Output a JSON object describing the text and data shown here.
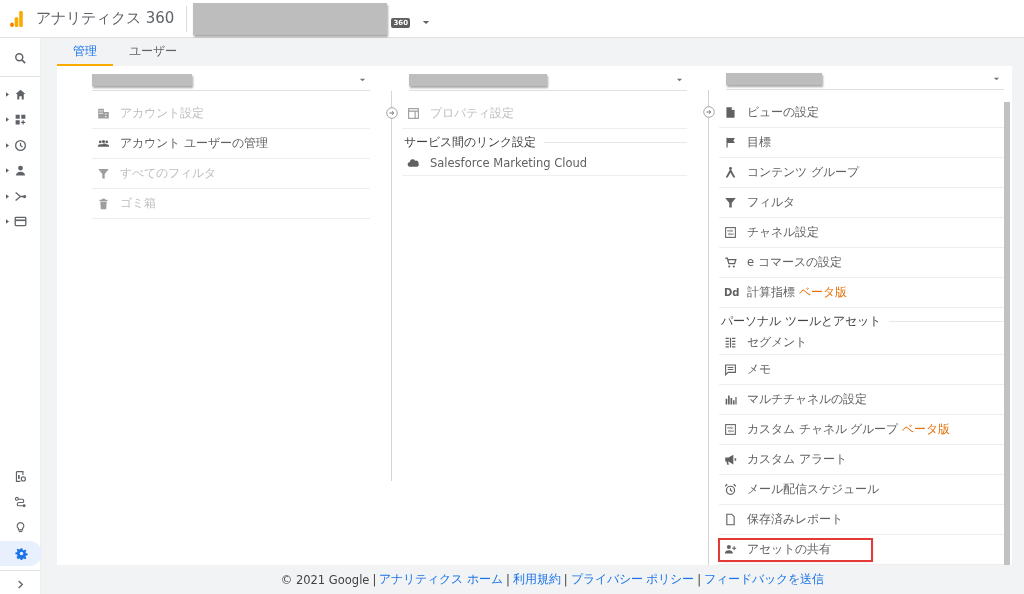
{
  "header": {
    "product": "アナリティクス 360",
    "badge": "360"
  },
  "tabs": [
    {
      "label": "管理",
      "selected": true
    },
    {
      "label": "ユーザー",
      "selected": false
    }
  ],
  "sidebar": {
    "top": [
      {
        "expandable": false,
        "selected": false
      },
      {
        "expandable": true,
        "selected": false
      },
      {
        "expandable": true,
        "selected": false
      },
      {
        "expandable": true,
        "selected": false
      },
      {
        "expandable": true,
        "selected": false
      },
      {
        "expandable": true,
        "selected": false
      },
      {
        "expandable": true,
        "selected": false
      }
    ],
    "bottom": [
      {
        "selected": false
      },
      {
        "selected": false
      },
      {
        "selected": false
      },
      {
        "selected": true
      }
    ]
  },
  "columns": [
    {
      "items": [
        {
          "kind": "item",
          "label": "アカウント設定",
          "disabled": true
        },
        {
          "kind": "item",
          "label": "アカウント ユーザーの管理",
          "disabled": false
        },
        {
          "kind": "item",
          "label": "すべてのフィルタ",
          "disabled": true
        },
        {
          "kind": "item",
          "label": "ゴミ箱",
          "disabled": true
        }
      ]
    },
    {
      "items": [
        {
          "kind": "item",
          "label": "プロパティ設定",
          "disabled": true
        },
        {
          "kind": "section",
          "label": "サービス間のリンク設定"
        },
        {
          "kind": "item",
          "label": "Salesforce Marketing Cloud",
          "disabled": false
        }
      ]
    },
    {
      "items": [
        {
          "kind": "item",
          "label": "ビューの設定",
          "disabled": false
        },
        {
          "kind": "item",
          "label": "目標",
          "disabled": false
        },
        {
          "kind": "item",
          "label": "コンテンツ グループ",
          "disabled": false
        },
        {
          "kind": "item",
          "label": "フィルタ",
          "disabled": false
        },
        {
          "kind": "item",
          "label": "チャネル設定",
          "disabled": false
        },
        {
          "kind": "item",
          "label": "e コマースの設定",
          "disabled": false
        },
        {
          "kind": "item",
          "label": "計算指標",
          "glyph": "Dd",
          "badge": "ベータ版",
          "disabled": false
        },
        {
          "kind": "section",
          "label": "パーソナル ツールとアセット"
        },
        {
          "kind": "item",
          "label": "セグメント",
          "disabled": false
        },
        {
          "kind": "item",
          "label": "メモ",
          "disabled": false
        },
        {
          "kind": "item",
          "label": "マルチチャネルの設定",
          "disabled": false
        },
        {
          "kind": "item",
          "label": "カスタム チャネル グループ",
          "badge": "ベータ版",
          "disabled": false
        },
        {
          "kind": "item",
          "label": "カスタム アラート",
          "disabled": false
        },
        {
          "kind": "item",
          "label": "メール配信スケジュール",
          "disabled": false
        },
        {
          "kind": "item",
          "label": "保存済みレポート",
          "disabled": false
        },
        {
          "kind": "item",
          "label": "アセットの共有",
          "disabled": false,
          "highlighted": true
        }
      ]
    }
  ],
  "footer": {
    "copyright": "© 2021 Google",
    "links": [
      "アナリティクス ホーム",
      "利用規約",
      "プライバシー ポリシー",
      "フィードバックを送信"
    ],
    "separator": "|"
  }
}
